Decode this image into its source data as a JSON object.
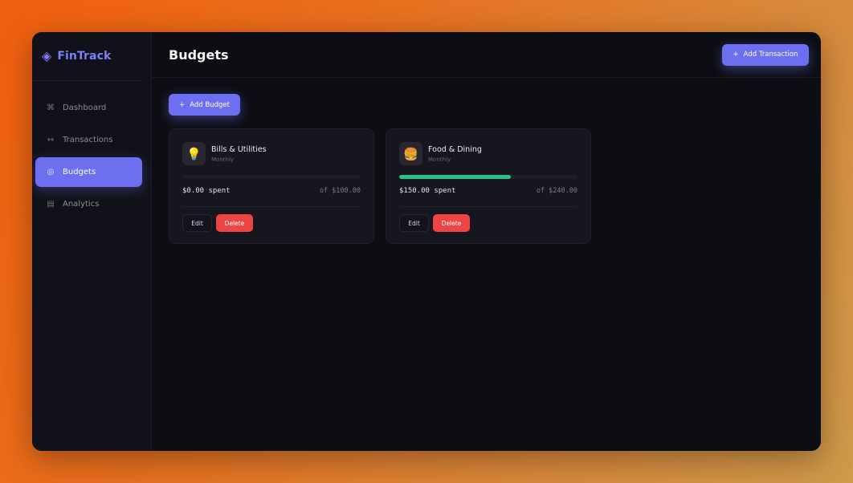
{
  "app": {
    "brand_icon": "◈",
    "brand_name": "FinTrack",
    "accent_color": "#6c70f0"
  },
  "sidebar": {
    "items": [
      {
        "icon": "⌘",
        "icon_name": "dashboard-icon",
        "label": "Dashboard",
        "active": false
      },
      {
        "icon": "↔",
        "icon_name": "transactions-icon",
        "label": "Transactions",
        "active": false
      },
      {
        "icon": "◎",
        "icon_name": "budgets-icon",
        "label": "Budgets",
        "active": true
      },
      {
        "icon": "▤",
        "icon_name": "analytics-icon",
        "label": "Analytics",
        "active": false
      }
    ]
  },
  "header": {
    "title": "Budgets",
    "add_transaction_label": "Add Transaction",
    "add_transaction_icon": "+"
  },
  "toolbar": {
    "add_budget_label": "Add Budget",
    "add_budget_icon": "+"
  },
  "budgets": [
    {
      "icon": "💡",
      "icon_name": "lightbulb-icon",
      "name": "Bills & Utilities",
      "period": "Monthly",
      "spent": "$0.00 spent",
      "total": "of $100.00",
      "progress": 0.0,
      "progress_color": "#22c48a",
      "edit_label": "Edit",
      "delete_label": "Delete"
    },
    {
      "icon": "🍔",
      "icon_name": "burger-icon",
      "name": "Food & Dining",
      "period": "Monthly",
      "spent": "$150.00 spent",
      "total": "of $240.00",
      "progress": 0.625,
      "progress_color": "#22c48a",
      "edit_label": "Edit",
      "delete_label": "Delete"
    }
  ]
}
